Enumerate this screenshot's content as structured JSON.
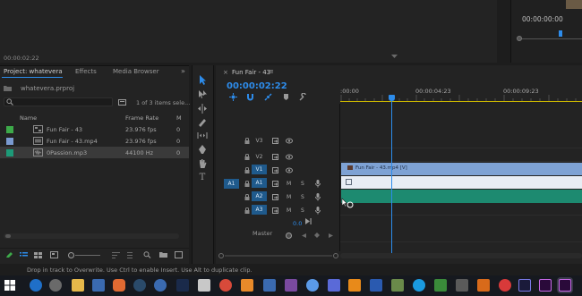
{
  "program_monitor": {
    "timecode": "00:00:00:00"
  },
  "source_monitor": {
    "timecode": "00:00:02:22"
  },
  "project_panel": {
    "tabs": [
      "Project: whatevera",
      "Effects",
      "Media Browser"
    ],
    "project_file": "whatevera.prproj",
    "item_count": "1 of 3 items sele...",
    "columns": {
      "name": "Name",
      "framerate": "Frame Rate",
      "m": "M"
    },
    "items": [
      {
        "name": "Fun Fair - 43",
        "framerate": "23.976 fps",
        "m": "0",
        "color": "#3daa4a",
        "icon": "sequence-icon"
      },
      {
        "name": "Fun Fair - 43.mp4",
        "framerate": "23.976 fps",
        "m": "0",
        "color": "#7a9ad0",
        "icon": "video-clip-icon"
      },
      {
        "name": "0Passion.mp3",
        "framerate": "44100 Hz",
        "m": "0",
        "color": "#1d9a78",
        "icon": "audio-clip-icon",
        "selected": true
      }
    ]
  },
  "timeline": {
    "sequence_name": "Fun Fair - 43",
    "timecode": "00:00:02:22",
    "ruler_labels": [
      ":00:00",
      "00:00:04:23",
      "00:00:09:23"
    ],
    "tracks": {
      "v3": "V3",
      "v2": "V2",
      "v1": "V1",
      "a1": "A1",
      "a2": "A2",
      "a3": "A3",
      "src_a1": "A1",
      "m": "M",
      "s": "S"
    },
    "clip_v1_label": "Fun Fair - 43.mp4 [V]",
    "master_label": "Master",
    "master_value": "0.0"
  },
  "status_bar": {
    "text": "Drop in track to Overwrite. Use Ctrl to enable Insert. Use Alt to duplicate clip."
  },
  "taskbar": {
    "icons": [
      "edge-icon",
      "chrome-icon",
      "explorer-icon",
      "store-icon",
      "brave-icon",
      "steam-icon",
      "settings-icon",
      "ps-icon",
      "calculator-icon",
      "chrome2-icon",
      "app-icon",
      "chat-icon",
      "notes-icon",
      "media-icon",
      "discord-icon",
      "vlc-icon",
      "word-icon",
      "photos-icon",
      "skype-icon",
      "nvidia-icon",
      "camera-icon",
      "ai-icon",
      "ru-icon",
      "ae-icon",
      "pr-icon"
    ]
  },
  "colors": {
    "accent": "#2d8ceb",
    "video_clip": "#7ea2d4",
    "audio_clip": "#1d8a70",
    "in_out_line": "#c8b400"
  }
}
